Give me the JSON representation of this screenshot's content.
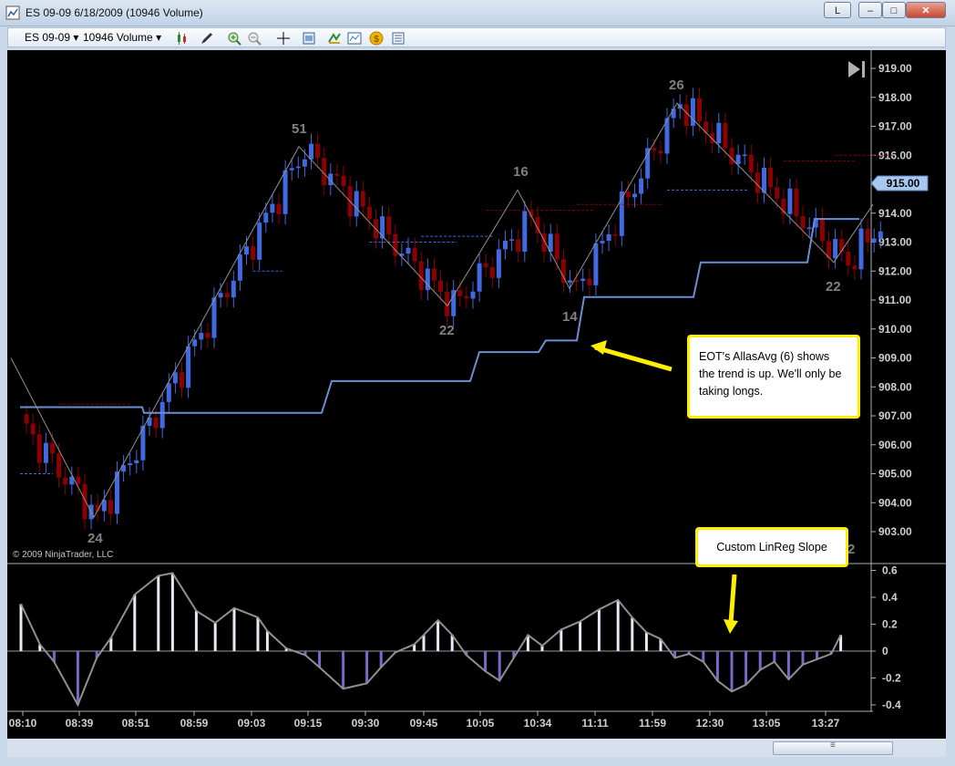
{
  "window": {
    "title": "ES 09-09  6/18/2009 (10946 Volume)",
    "btn_l": "L",
    "btn_min": "–",
    "btn_max": "□",
    "btn_close": "✕"
  },
  "toolbar": {
    "instrument": "ES 09-09",
    "period": "10946 Volume",
    "icons": [
      "candlestick-icon",
      "pencil-draw-icon",
      "zoom-in-icon",
      "zoom-out-icon",
      "crosshair-icon",
      "properties-icon",
      "strategy-icon",
      "indicator-icon",
      "coin-icon",
      "data-box-icon"
    ]
  },
  "chart": {
    "copyright": "© 2009 NinjaTrader, LLC",
    "last_price": "915.00",
    "price_ticks": [
      "919.00",
      "918.00",
      "917.00",
      "916.00",
      "915.00",
      "914.00",
      "913.00",
      "912.00",
      "911.00",
      "910.00",
      "909.00",
      "908.00",
      "907.00",
      "906.00",
      "905.00",
      "904.00",
      "903.00"
    ],
    "zigzag_labels": [
      "24",
      "51",
      "22",
      "16",
      "14",
      "26",
      "22",
      "2"
    ],
    "colors": {
      "up": "#4169e1",
      "down": "#8b0000",
      "trend": "#6a8fd0",
      "zigzag": "#909090",
      "label": "#808080",
      "accent": "#ffee00"
    }
  },
  "indicator": {
    "ticks": [
      "0.6",
      "0.4",
      "0.2",
      "0",
      "-0.2",
      "-0.4"
    ],
    "colors": {
      "pos": "#e8e8f5",
      "neg": "#7b68c8",
      "line": "#909090"
    }
  },
  "time_axis": [
    "08:10",
    "08:39",
    "08:51",
    "08:59",
    "09:03",
    "09:15",
    "09:30",
    "09:45",
    "10:05",
    "10:34",
    "11:11",
    "11:59",
    "12:30",
    "13:05",
    "13:27"
  ],
  "annotations": {
    "trend_note": "EOT's AllasAvg (6) shows the trend is up.  We'll only be taking longs.",
    "linreg_note": "Custom LinReg Slope"
  }
}
